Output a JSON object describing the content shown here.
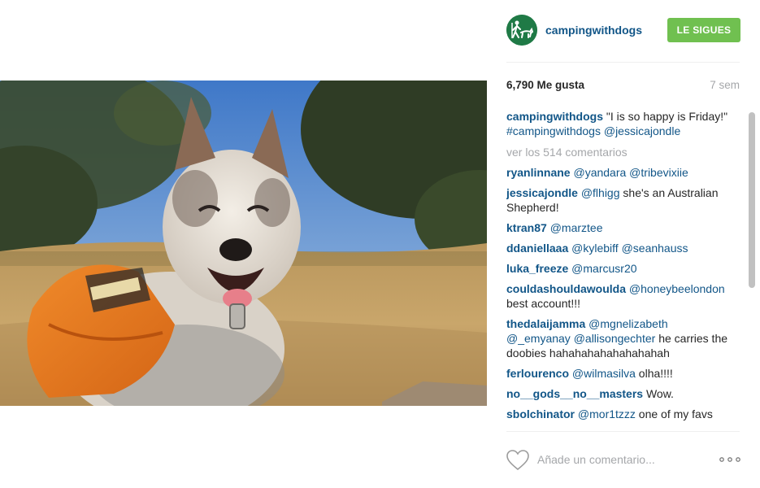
{
  "post": {
    "username": "campingwithdogs",
    "follow_label": "LE SIGUES",
    "likes": "6,790 Me gusta",
    "time": "7 sem",
    "load_more": "ver los 514 comentarios",
    "comment_placeholder": "Añade un comentario..."
  },
  "caption": {
    "user": "campingwithdogs",
    "text": " \"I is so happy is Friday!\" ",
    "hashtag": "#campingwithdogs",
    "mention": "@jessicajondle"
  },
  "comments": [
    {
      "user": "ryanlinnane",
      "parts": [
        {
          "t": "m",
          "v": " @yandara"
        },
        {
          "t": "m",
          "v": " @tribevixiie"
        }
      ]
    },
    {
      "user": "jessicajondle",
      "parts": [
        {
          "t": "m",
          "v": " @flhigg"
        },
        {
          "t": "x",
          "v": " she's an Australian Shepherd!"
        }
      ]
    },
    {
      "user": "ktran87",
      "parts": [
        {
          "t": "m",
          "v": " @marztee"
        }
      ]
    },
    {
      "user": "ddaniellaaa",
      "parts": [
        {
          "t": "m",
          "v": " @kylebiff"
        },
        {
          "t": "m",
          "v": " @seanhauss"
        }
      ]
    },
    {
      "user": "luka_freeze",
      "parts": [
        {
          "t": "m",
          "v": " @marcusr20"
        }
      ]
    },
    {
      "user": "couldashouldawoulda",
      "parts": [
        {
          "t": "m",
          "v": " @honeybeelondon"
        },
        {
          "t": "x",
          "v": " best account!!!"
        }
      ]
    },
    {
      "user": "thedalaijamma",
      "parts": [
        {
          "t": "m",
          "v": " @mgnelizabeth"
        },
        {
          "t": "m",
          "v": " @_emyanay"
        },
        {
          "t": "m",
          "v": " @allisongechter"
        },
        {
          "t": "x",
          "v": " he carries the doobies hahahahahahahahahah"
        }
      ]
    },
    {
      "user": "ferlourenco",
      "parts": [
        {
          "t": "m",
          "v": " @wilmasilva"
        },
        {
          "t": "x",
          "v": " olha!!!!"
        }
      ]
    },
    {
      "user": "no__gods__no__masters",
      "parts": [
        {
          "t": "x",
          "v": " Wow."
        }
      ]
    },
    {
      "user": "sbolchinator",
      "parts": [
        {
          "t": "m",
          "v": " @mor1tzzz"
        },
        {
          "t": "x",
          "v": " one of my favs"
        }
      ]
    }
  ],
  "icons": {
    "avatar": "hiker-with-dog-logo",
    "like": "heart-outline-icon",
    "more": "ellipsis-icon"
  },
  "colors": {
    "link": "#125688",
    "follow_button": "#70c050",
    "muted": "#a5a7aa",
    "avatar_bg": "#1f7a46"
  }
}
